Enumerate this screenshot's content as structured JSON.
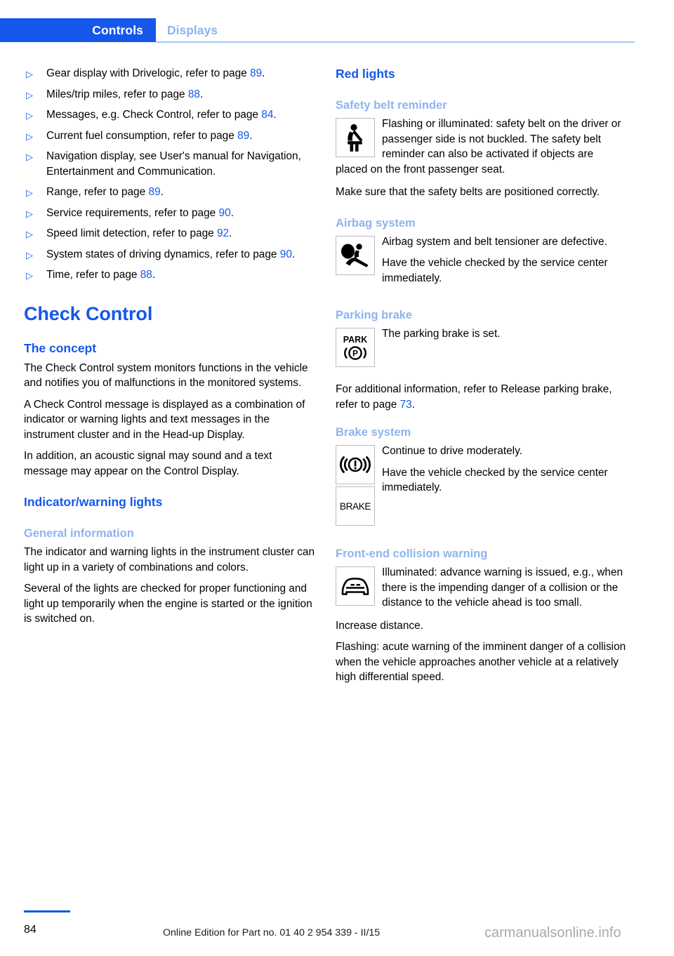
{
  "header": {
    "active_tab": "Controls",
    "inactive_tab": "Displays",
    "accent_color": "#1557ea",
    "muted_accent_color": "#8db4ef"
  },
  "left_column": {
    "bullets": [
      {
        "text_before": "Gear display with Drivelogic, refer to page ",
        "page": "89",
        "text_after": "."
      },
      {
        "text_before": "Miles/trip miles, refer to page ",
        "page": "88",
        "text_after": "."
      },
      {
        "text_before": "Messages, e.g. Check Control, refer to page ",
        "page": "84",
        "text_after": "."
      },
      {
        "text_before": "Current fuel consumption, refer to page ",
        "page": "89",
        "text_after": "."
      },
      {
        "text_before": "Navigation display, see User's manual for Navigation, Entertainment and Communication.",
        "page": "",
        "text_after": ""
      },
      {
        "text_before": "Range, refer to page ",
        "page": "89",
        "text_after": "."
      },
      {
        "text_before": "Service requirements, refer to page ",
        "page": "90",
        "text_after": "."
      },
      {
        "text_before": "Speed limit detection, refer to page ",
        "page": "92",
        "text_after": "."
      },
      {
        "text_before": "System states of driving dynamics, refer to page ",
        "page": "90",
        "text_after": "."
      },
      {
        "text_before": "Time, refer to page ",
        "page": "88",
        "text_after": "."
      }
    ],
    "check_control_title": "Check Control",
    "concept_heading": "The concept",
    "concept_paragraphs": [
      "The Check Control system monitors functions in the vehicle and notifies you of malfunctions in the monitored systems.",
      "A Check Control message is displayed as a combination of indicator or warning lights and text messages in the instrument cluster and in the Head-up Display.",
      "In addition, an acoustic signal may sound and a text message may appear on the Control Display."
    ],
    "indicator_lights_heading": "Indicator/warning lights",
    "general_info_heading": "General information",
    "general_info_paragraphs": [
      "The indicator and warning lights in the instrument cluster can light up in a variety of combinations and colors.",
      "Several of the lights are checked for proper functioning and light up temporarily when the engine is started or the ignition is switched on."
    ]
  },
  "right_column": {
    "red_lights_heading": "Red lights",
    "sections": [
      {
        "heading": "Safety belt reminder",
        "icon": "seatbelt-reminder-icon",
        "paragraphs": [
          "Flashing or illuminated: safety belt on the driver or passenger side is not buckled. The safety belt reminder can also be activated if objects are placed on the front passenger seat.",
          "Make sure that the safety belts are positioned correctly."
        ]
      },
      {
        "heading": "Airbag system",
        "icon": "airbag-system-icon",
        "paragraphs": [
          "Airbag system and belt tensioner are defective.",
          "Have the vehicle checked by the service center immediately."
        ]
      },
      {
        "heading": "Parking brake",
        "icon": "parking-brake-icon",
        "paragraphs": [
          "The parking brake is set."
        ],
        "after_text_before": "For additional information, refer to Release parking brake, refer to page ",
        "after_page": "73",
        "after_text_after": "."
      },
      {
        "heading": "Brake system",
        "icon": "brake-warning-icon",
        "icon2": "brake-word-icon",
        "icon2_label": "BRAKE",
        "paragraphs": [
          "Continue to drive moderately.",
          "Have the vehicle checked by the service center immediately."
        ]
      },
      {
        "heading": "Front-end collision warning",
        "icon": "front-collision-icon",
        "paragraphs": [
          "Illuminated: advance warning is issued, e.g., when there is the impending danger of a collision or the distance to the vehicle ahead is too small.",
          "Increase distance.",
          "Flashing: acute warning of the imminent danger of a collision when the vehicle approaches another vehicle at a relatively high differential speed."
        ]
      }
    ]
  },
  "footer": {
    "page_number": "84",
    "edition_note": "Online Edition for Part no. 01 40 2 954 339 - II/15",
    "watermark": "carmanualsonline.info"
  }
}
